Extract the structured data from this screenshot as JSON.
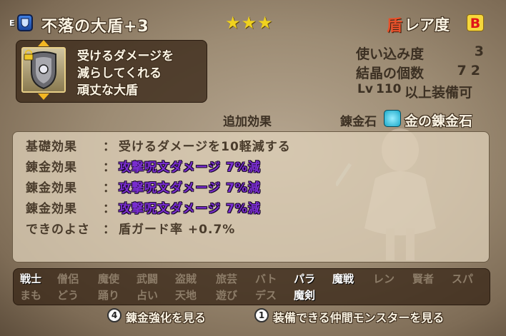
{
  "header": {
    "slot_letter": "E",
    "item_name": "不落の大盾+3",
    "stars": "★★★",
    "rarity_icon_char": "盾",
    "rarity_label": "レア度",
    "rarity_value": "B"
  },
  "description": {
    "lines": [
      "受けるダメージを",
      "減らしてくれる",
      "頑丈な大盾"
    ]
  },
  "stats": {
    "usage_label": "使い込み度",
    "usage_value": "3",
    "crystal_label": "結晶の個数",
    "crystal_value": "72",
    "level_prefix": "Lv",
    "level_value": "110",
    "level_suffix": "以上装備可"
  },
  "extra": {
    "extra_effects_label": "追加効果",
    "stone_label": "錬金石",
    "stone_value": "金の錬金石"
  },
  "effects": [
    {
      "label": "基礎効果",
      "colon": "：",
      "value": "受けるダメージを10軽減する",
      "style": "plain"
    },
    {
      "label": "錬金効果",
      "colon": "：",
      "value": "攻撃呪文ダメージ 7%減",
      "style": "purple"
    },
    {
      "label": "錬金効果",
      "colon": "：",
      "value": "攻撃呪文ダメージ 7%減",
      "style": "purple"
    },
    {
      "label": "錬金効果",
      "colon": "：",
      "value": "攻撃呪文ダメージ 7%減",
      "style": "purple"
    },
    {
      "label": "できのよさ",
      "colon": "：",
      "value": "盾ガード率 +0.7%",
      "style": "plain"
    }
  ],
  "jobs": {
    "row1": [
      "戦士",
      "僧侶",
      "魔使",
      "武闘",
      "盗賊",
      "旅芸",
      "バト",
      "パラ",
      "魔戦",
      "レン",
      "賢者",
      "スパ"
    ],
    "row2": [
      "まも",
      "どう",
      "踊り",
      "占い",
      "天地",
      "遊び",
      "デス",
      "魔剣"
    ],
    "row1_enabled": [
      true,
      false,
      false,
      false,
      false,
      false,
      false,
      true,
      true,
      false,
      false,
      false
    ],
    "row2_enabled": [
      false,
      false,
      false,
      false,
      false,
      false,
      false,
      true
    ]
  },
  "footer": {
    "btn4_key": "4",
    "btn4_label": "錬金強化を見る",
    "btn1_key": "1",
    "btn1_label": "装備できる仲間モンスターを見る"
  },
  "colors": {
    "purple_effect": "#7a2ed0",
    "rarity_bg": "#f6d73c",
    "rarity_fg": "#e0141a",
    "stars": "#f0d21e"
  }
}
